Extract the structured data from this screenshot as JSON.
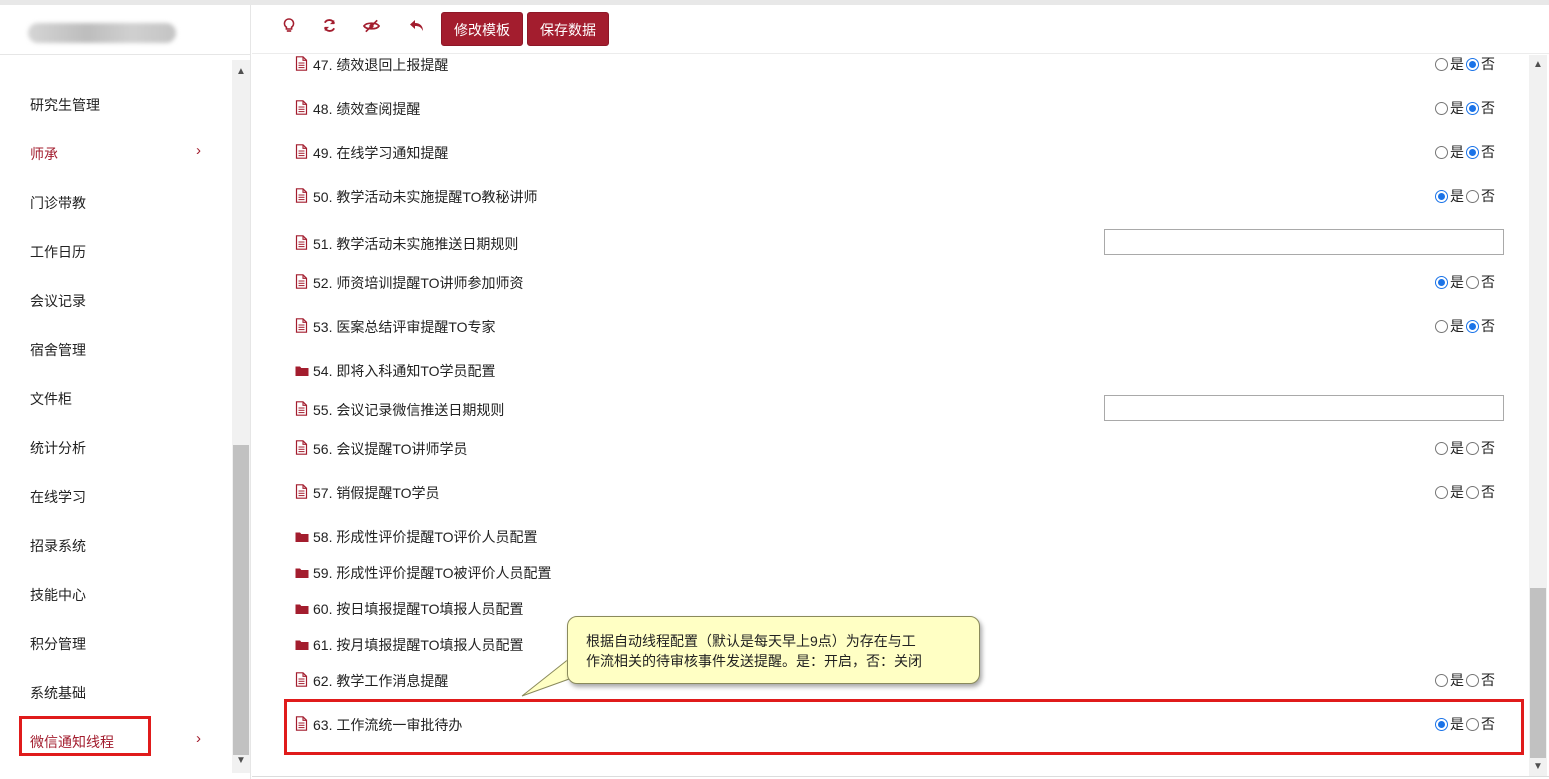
{
  "sidebar": {
    "items": [
      {
        "label": "研究生管理",
        "active": false,
        "chevron": false
      },
      {
        "label": "师承",
        "active": true,
        "chevron": true
      },
      {
        "label": "门诊带教",
        "active": false,
        "chevron": false
      },
      {
        "label": "工作日历",
        "active": false,
        "chevron": false
      },
      {
        "label": "会议记录",
        "active": false,
        "chevron": false
      },
      {
        "label": "宿舍管理",
        "active": false,
        "chevron": false
      },
      {
        "label": "文件柜",
        "active": false,
        "chevron": false
      },
      {
        "label": "统计分析",
        "active": false,
        "chevron": false
      },
      {
        "label": "在线学习",
        "active": false,
        "chevron": false
      },
      {
        "label": "招录系统",
        "active": false,
        "chevron": false
      },
      {
        "label": "技能中心",
        "active": false,
        "chevron": false
      },
      {
        "label": "积分管理",
        "active": false,
        "chevron": false
      },
      {
        "label": "系统基础",
        "active": false,
        "chevron": false
      },
      {
        "label": "微信通知线程",
        "active": true,
        "chevron": true
      }
    ],
    "chevron_glyph": "›"
  },
  "toolbar": {
    "icons": [
      "bulb-icon",
      "refresh-icon",
      "hide-icon",
      "undo-icon"
    ],
    "edit_template_label": "修改模板",
    "save_data_label": "保存数据"
  },
  "radio": {
    "yes": "是",
    "no": "否"
  },
  "rows": [
    {
      "label": "47. 绩效退回上报提醒",
      "kind": "doc",
      "control": "radio",
      "value": "no"
    },
    {
      "label": "48. 绩效查阅提醒",
      "kind": "doc",
      "control": "radio",
      "value": "no"
    },
    {
      "label": "49. 在线学习通知提醒",
      "kind": "doc",
      "control": "radio",
      "value": "no"
    },
    {
      "label": "50. 教学活动未实施提醒TO教秘讲师",
      "kind": "doc",
      "control": "radio",
      "value": "yes"
    },
    {
      "label": "51. 教学活动未实施推送日期规则",
      "kind": "doc",
      "control": "text",
      "value": ""
    },
    {
      "label": "52. 师资培训提醒TO讲师参加师资",
      "kind": "doc",
      "control": "radio",
      "value": "yes"
    },
    {
      "label": "53. 医案总结评审提醒TO专家",
      "kind": "doc",
      "control": "radio",
      "value": "no"
    },
    {
      "label": "54. 即将入科通知TO学员配置",
      "kind": "folder",
      "control": "none",
      "value": ""
    },
    {
      "label": "55. 会议记录微信推送日期规则",
      "kind": "doc",
      "control": "text",
      "value": ""
    },
    {
      "label": "56. 会议提醒TO讲师学员",
      "kind": "doc",
      "control": "radio",
      "value": "none"
    },
    {
      "label": "57. 销假提醒TO学员",
      "kind": "doc",
      "control": "radio",
      "value": "none"
    },
    {
      "label": "58. 形成性评价提醒TO评价人员配置",
      "kind": "folder",
      "control": "none",
      "value": ""
    },
    {
      "label": "59. 形成性评价提醒TO被评价人员配置",
      "kind": "folder",
      "control": "none",
      "value": ""
    },
    {
      "label": "60. 按日填报提醒TO填报人员配置",
      "kind": "folder",
      "control": "none",
      "value": ""
    },
    {
      "label": "61. 按月填报提醒TO填报人员配置",
      "kind": "folder",
      "control": "none",
      "value": ""
    },
    {
      "label": "62. 教学工作消息提醒",
      "kind": "doc",
      "control": "radio",
      "value": "none"
    },
    {
      "label": "63. 工作流统一审批待办",
      "kind": "doc",
      "control": "radio",
      "value": "yes"
    }
  ],
  "tooltip": {
    "line1": "根据自动线程配置（默认是每天早上9点）为存在与工",
    "line2": "作流相关的待审核事件发送提醒。是：开启，否：关闭"
  },
  "colors": {
    "accent": "#a31d2e",
    "highlight": "#e01b1b",
    "radio_on": "#1a73e8",
    "tooltip_bg": "#ffffc4"
  }
}
